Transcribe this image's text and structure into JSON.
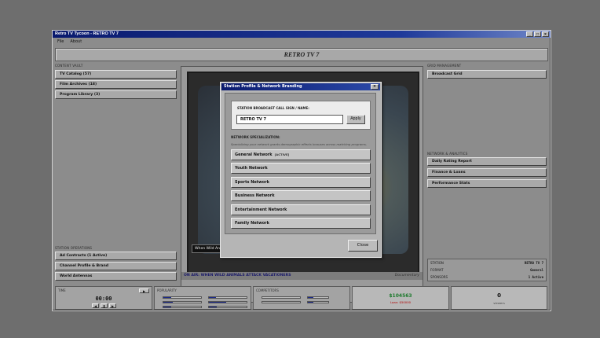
{
  "window": {
    "title": "Retro TV Tycoon - RETRO TV 7"
  },
  "menu": [
    "File",
    "About"
  ],
  "banner": "RETRO TV 7",
  "left": {
    "content_vault_label": "CONTENT VAULT",
    "vault_items": [
      "TV Catalog (57)",
      "Film Archives (18)",
      "Program Library (3)"
    ],
    "station_ops_label": "STATION OPERATIONS",
    "ops_items": [
      "Ad Contracts (1 Active)",
      "Channel Profile & Brand",
      "World Antennas"
    ]
  },
  "right": {
    "grid_label": "GRID MANAGEMENT",
    "grid_items": [
      "Broadcast Grid"
    ],
    "analytics_label": "NETWORK & ANALYTICS",
    "analytics_items": [
      "Daily Rating Report",
      "Finance & Loans",
      "Performance Stats"
    ],
    "stats": [
      {
        "k": "STATION",
        "v": "RETRO TV 7"
      },
      {
        "k": "FORMAT",
        "v": "General"
      },
      {
        "k": "SPONSORS",
        "v": "1 Active"
      }
    ]
  },
  "tv": {
    "caption": "When Wild Animals Attack",
    "ticker": "ON AIR: WHEN WILD ANIMALS ATTACK VACATIONERS",
    "ticker_sub": "Documentary"
  },
  "bottom": {
    "time_label": "TIME",
    "time_value": "00:00",
    "pop_label": "POPULARITY",
    "ratings_label": "COMPETITORS",
    "money_value": "$104563",
    "money_sub": "Loan: $50000",
    "count_value": "0",
    "count_sub": "viewers"
  },
  "modal": {
    "title": "Station Profile & Network Branding",
    "call_label": "STATION BROADCAST CALL SIGN / NAME:",
    "call_value": "RETRO TV 7",
    "apply": "Apply",
    "spec_label": "NETWORK SPECIALIZATION:",
    "spec_hint": "Specializing your network grants demographic effects bonuses across matching programs.",
    "networks": [
      {
        "label": "General Network",
        "tag": "[ACTIVE]"
      },
      {
        "label": "Youth Network",
        "tag": ""
      },
      {
        "label": "Sports Network",
        "tag": ""
      },
      {
        "label": "Business Network",
        "tag": ""
      },
      {
        "label": "Entertainment Network",
        "tag": ""
      },
      {
        "label": "Family Network",
        "tag": ""
      }
    ],
    "close": "Close"
  },
  "colors": {
    "titlebar": "#0a1a6e",
    "money": "#1e7a2e",
    "loan": "#b00000"
  }
}
